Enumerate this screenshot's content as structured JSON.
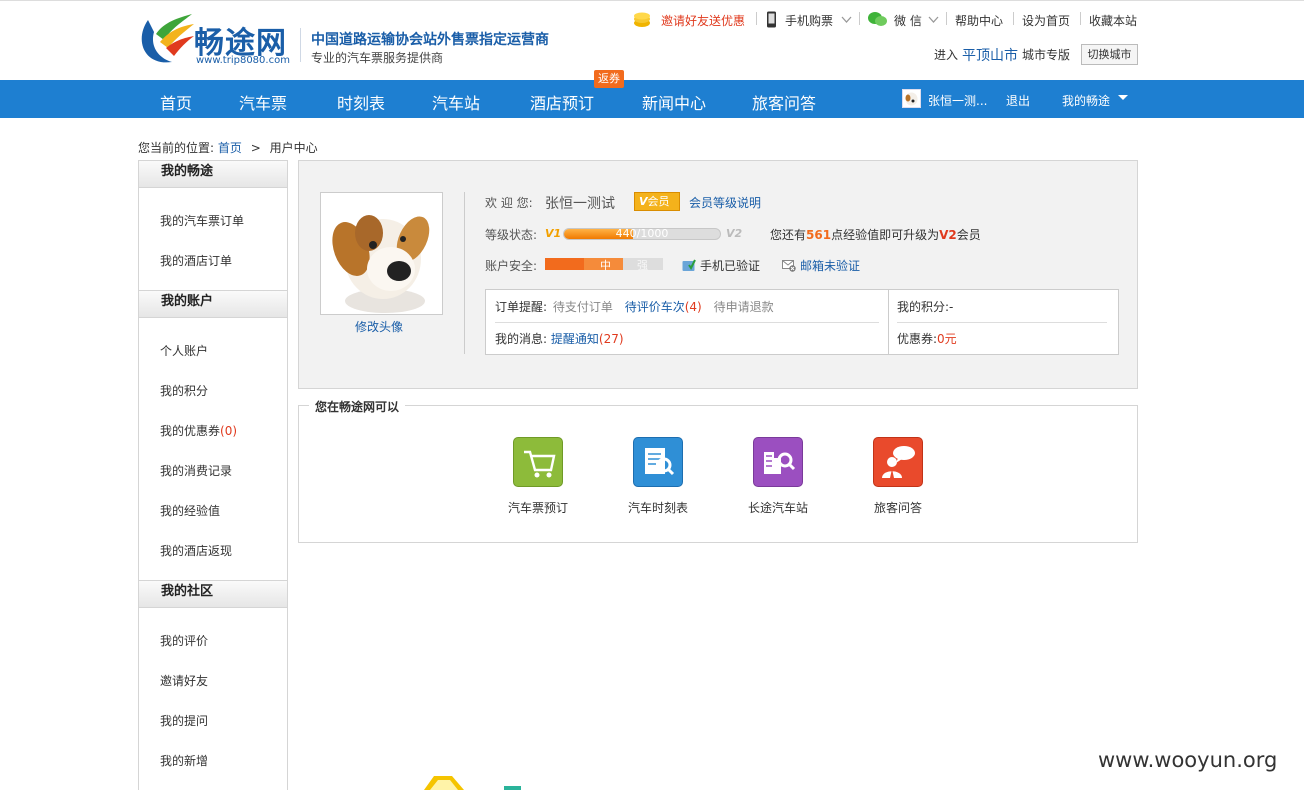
{
  "header": {
    "logo_text": "畅途网",
    "logo_url": "www.trip8080.com",
    "slogan_main": "中国道路运输协会站外售票指定运营商",
    "slogan_sub": "专业的汽车票服务提供商",
    "links": {
      "invite": "邀请好友送优惠",
      "mobile": "手机购票",
      "wechat": "微 信",
      "help": "帮助中心",
      "homepage": "设为首页",
      "favorite": "收藏本站"
    },
    "city": {
      "prefix": "进入",
      "name": "平顶山市",
      "suffix": "城市专版",
      "switch_label": "切换城市"
    }
  },
  "nav": {
    "items": [
      "首页",
      "汽车票",
      "时刻表",
      "汽车站",
      "酒店预订",
      "新闻中心",
      "旅客问答"
    ],
    "promo_badge": "返券",
    "user_name": "张恒一测...",
    "logout": "退出",
    "my_label": "我的畅途"
  },
  "breadcrumb": {
    "prefix": "您当前的位置:",
    "home": "首页",
    "sep": ">",
    "current": "用户中心"
  },
  "sidebar": {
    "sections": [
      {
        "title": "我的畅途",
        "items": [
          "我的汽车票订单",
          "我的酒店订单"
        ]
      },
      {
        "title": "我的账户",
        "items": [
          "个人账户",
          "我的积分",
          "我的优惠券",
          "我的消费记录",
          "我的经验值",
          "我的酒店返现"
        ]
      },
      {
        "title": "我的社区",
        "items": [
          "我的评价",
          "邀请好友",
          "我的提问",
          "我的新增"
        ]
      }
    ],
    "coupon_count": "(0)"
  },
  "profile": {
    "edit_avatar": "修改头像",
    "welcome_label": "欢 迎 您:",
    "user_name": "张恒一测试",
    "badge": "会员",
    "level_link": "会员等级说明",
    "level_label": "等级状态:",
    "level_from": "V1",
    "level_to": "V2",
    "progress_text": "440/1000",
    "progress_fraction": 0.44,
    "upgrade_prefix": "您还有",
    "upgrade_points": "561",
    "upgrade_mid": "点经验值即可升级为",
    "upgrade_level": "V2",
    "upgrade_suffix": "会员",
    "security_label": "账户安全:",
    "security_level": "中",
    "security_strong": "强",
    "phone_verified": "手机已验证",
    "email_unverified": "邮箱未验证",
    "order_label": "订单提醒:",
    "order_pay": "待支付订单",
    "order_review": "待评价车次",
    "order_review_count": "(4)",
    "order_refund": "待申请退款",
    "msg_label": "我的消息:",
    "msg_link": "提醒通知",
    "msg_count": "(27)",
    "points_label": "我的积分:",
    "points_value": "-",
    "coupon_label": "优惠券:",
    "coupon_value": "0元"
  },
  "cando": {
    "title": "您在畅途网可以",
    "services": [
      {
        "label": "汽车票预订",
        "icon": "cart-icon",
        "color": "#8dbb3a"
      },
      {
        "label": "汽车时刻表",
        "icon": "schedule-search-icon",
        "color": "#2f8fd6"
      },
      {
        "label": "长途汽车站",
        "icon": "station-search-icon",
        "color": "#9b4fc0"
      },
      {
        "label": "旅客问答",
        "icon": "qa-icon",
        "color": "#e94a2c"
      }
    ]
  },
  "watermark": "www.wooyun.org",
  "colors": {
    "nav_bg": "#1e7fd1",
    "brand_blue": "#1a5ea8",
    "accent_orange": "#f26b1d"
  }
}
